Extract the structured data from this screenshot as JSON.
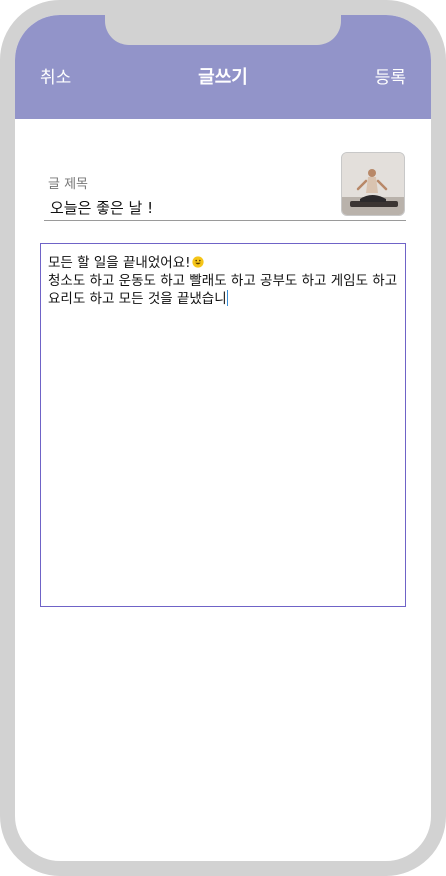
{
  "header": {
    "cancel_label": "취소",
    "title": "글쓰기",
    "submit_label": "등록"
  },
  "form": {
    "title_label": "글 제목",
    "title_value": "오늘은 좋은 날 !",
    "body_line1": "모든 할 일을 끝내었어요!",
    "body_rest": "청소도 하고 운동도 하고 빨래도 하고 공부도 하고 게임도 하고 요리도 하고 모든 것을 끝냈습니",
    "emoji_icon": "grinning-face-emoji",
    "thumbnail_icon": "yoga-photo"
  },
  "colors": {
    "header_bg": "#9294c9",
    "frame": "#d2d2d2",
    "textarea_border": "#6f63c7"
  }
}
